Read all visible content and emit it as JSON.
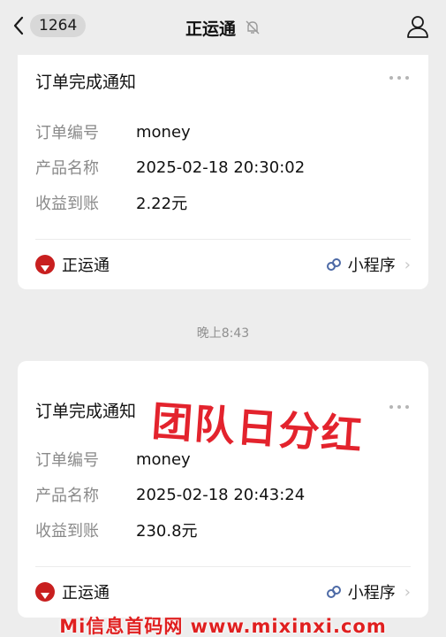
{
  "header": {
    "back_label": "<",
    "unread_count": "1264",
    "title": "正运通",
    "mute_icon": "bell-off-icon",
    "profile_icon": "person-icon"
  },
  "cards": [
    {
      "title": "订单完成通知",
      "rows": [
        {
          "label": "订单编号",
          "value": "money"
        },
        {
          "label": "产品名称",
          "value": "2025-02-18 20:30:02"
        },
        {
          "label": "收益到账",
          "value": "2.22元"
        }
      ],
      "brand": "正运通",
      "mini_program": "小程序"
    },
    {
      "title": "订单完成通知",
      "rows": [
        {
          "label": "订单编号",
          "value": "money"
        },
        {
          "label": "产品名称",
          "value": "2025-02-18 20:43:24"
        },
        {
          "label": "收益到账",
          "value": "230.8元"
        }
      ],
      "brand": "正运通",
      "mini_program": "小程序"
    }
  ],
  "timestamp": "晚上8:43",
  "overlay": {
    "stamp_text": "团队日分红",
    "watermark": "Mi信息首码网 www.mixinxi.com"
  },
  "colors": {
    "background": "#ededed",
    "card": "#ffffff",
    "stamp_red": "#e3232d",
    "brand_red": "#c81f1f"
  }
}
